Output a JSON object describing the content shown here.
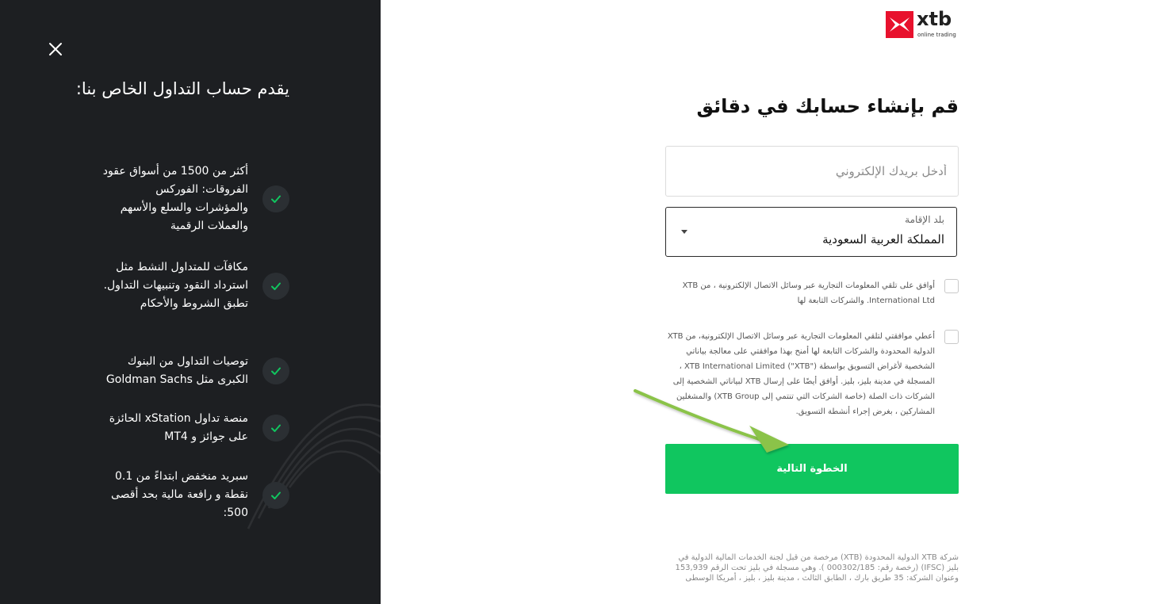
{
  "colors": {
    "panel_bg": "#1d1f22",
    "brand_red": "#e8112d",
    "accent_green": "#10c65f",
    "check_green": "#10c65f"
  },
  "panel": {
    "close_icon": "close-icon",
    "title": "يقدم حساب التداول الخاص بنا:",
    "benefits": [
      "أكثر من 1500 من أسواق عقود الفروقات: الفوركس والمؤشرات والسلع والأسهم والعملات الرقمية",
      "مكافآت للمتداول النشط مثل استرداد النقود وتنبيهات التداول. تطبق الشروط والأحكام",
      "توصيات التداول من البنوك الكبرى مثل Goldman Sachs",
      "منصة تداول xStation الحائزة على جوائز و MT4",
      "سبريد منخفض ابتداءً من 0.1 نقطة و رافعة مالية بحد أقصى 500:"
    ]
  },
  "logo": {
    "name": "xtb",
    "tagline": "online trading"
  },
  "form": {
    "headline": "قم بإنشاء حسابك في دقائق",
    "email_placeholder": "أدخل بريدك الإلكتروني",
    "email_value": "",
    "country_label": "بلد الإقامة",
    "country_value": "المملكة العربية السعودية",
    "consent_1": "أوافق على تلقي المعلومات التجارية عبر وسائل الاتصال الإلكترونية ، من XTB International Ltd. والشركات التابعة لها",
    "consent_2": "أعطي موافقتي لتلقي المعلومات التجارية عبر وسائل الاتصال الإلكترونية، من XTB الدولية المحدودة والشركات التابعة لها أمنح بهذا موافقتي على معالجة بياناتي الشخصية لأغراض التسويق بواسطة XTB International Limited (\"XTB\") ، المسجلة في مدينة بليز، بليز. أوافق أيضًا على إرسال XTB لبياناتي الشخصية إلى الشركات ذات الصلة (خاصة الشركات التي تنتمي إلى XTB Group) والمشغلين المشاركين ، بغرض إجراء أنشطة التسويق.",
    "next_button": "الخطوة التالية"
  },
  "footer": {
    "legal": "شركة XTB الدولية المحدودة (XTB) مرخصة من قبل لجنة الخدمات المالية الدولية في بليز (IFSC) (رخصة رقم: 000302/185 ). وهي مسجلة في بليز تحت الرقم 153,939 وعنوان الشركة: 35 طريق بارك ، الطابق الثالث ، مدينة بليز ، بليز ، أمريكا الوسطى"
  }
}
